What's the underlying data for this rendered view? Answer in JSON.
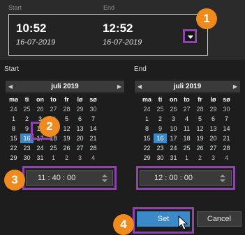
{
  "header": {
    "start_label": "Start",
    "end_label": "End",
    "start_time": "10:52",
    "start_date": "16-07-2019",
    "end_time": "12:52",
    "end_date": "16-07-2019",
    "dropdown_icon": "chevron-down-icon"
  },
  "panel": {
    "start_label": "Start",
    "end_label": "End"
  },
  "calendars": [
    {
      "month": "juli 2019",
      "weekdays": [
        "ma",
        "ti",
        "on",
        "to",
        "fr",
        "lø",
        "sø"
      ],
      "days": [
        [
          "24",
          "25",
          "26",
          "27",
          "28",
          "29",
          "30"
        ],
        [
          "1",
          "2",
          "3",
          "4",
          "5",
          "6",
          "7"
        ],
        [
          "8",
          "9",
          "10",
          "11",
          "12",
          "13",
          "14"
        ],
        [
          "15",
          "16",
          "17",
          "18",
          "19",
          "20",
          "21"
        ],
        [
          "22",
          "23",
          "24",
          "25",
          "26",
          "27",
          "28"
        ],
        [
          "29",
          "30",
          "31",
          "1",
          "2",
          "3",
          "4"
        ]
      ],
      "selected_day": "16"
    },
    {
      "month": "juli 2019",
      "weekdays": [
        "ma",
        "ti",
        "on",
        "to",
        "fr",
        "lø",
        "sø"
      ],
      "days": [
        [
          "24",
          "25",
          "26",
          "27",
          "28",
          "29",
          "30"
        ],
        [
          "1",
          "2",
          "3",
          "4",
          "5",
          "6",
          "7"
        ],
        [
          "8",
          "9",
          "10",
          "11",
          "12",
          "13",
          "14"
        ],
        [
          "15",
          "16",
          "17",
          "18",
          "19",
          "20",
          "21"
        ],
        [
          "22",
          "23",
          "24",
          "25",
          "26",
          "27",
          "28"
        ],
        [
          "29",
          "30",
          "31",
          "1",
          "2",
          "3",
          "4"
        ]
      ],
      "selected_day": "16"
    }
  ],
  "time_start": "11 : 40 : 00",
  "time_end": "12 : 00 : 00",
  "buttons": {
    "set": "Set",
    "cancel": "Cancel"
  },
  "badges": [
    "1",
    "2",
    "3",
    "4"
  ],
  "colors": {
    "accent_blue": "#3b89c9",
    "highlight_purple": "#8e44ad",
    "badge_orange": "#ef8a1f"
  }
}
